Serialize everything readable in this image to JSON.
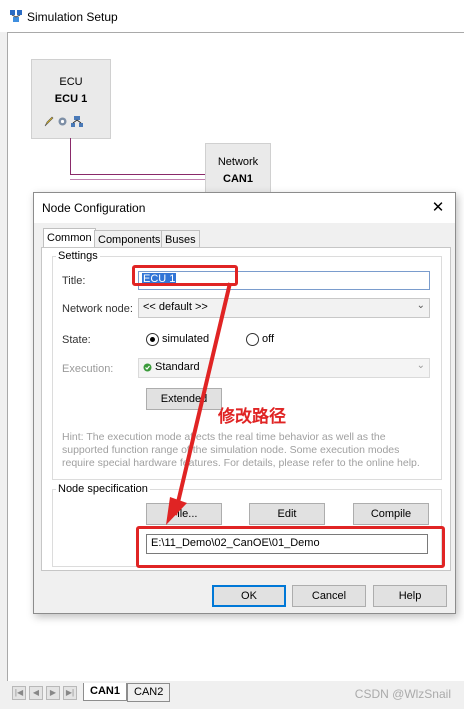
{
  "window": {
    "title": "Simulation Setup"
  },
  "canvas": {
    "ecu_node": {
      "line1": "ECU",
      "line2": "ECU 1"
    },
    "network_node": {
      "line1": "Network",
      "line2": "CAN1"
    }
  },
  "sheet_tabs": [
    "CAN1",
    "CAN2"
  ],
  "watermark": "CSDN @WlzSnail",
  "dialog": {
    "title": "Node Configuration",
    "close_label": "✕",
    "tabs": [
      "Common",
      "Components",
      "Buses"
    ],
    "settings": {
      "group_label": "Settings",
      "title_label": "Title:",
      "title_value": "ECU 1",
      "network_node_label": "Network node:",
      "network_node_value": "<< default >>",
      "state_label": "State:",
      "state_options": [
        "simulated",
        "off"
      ],
      "state_selected": "simulated",
      "execution_label": "Execution:",
      "execution_value": "Standard",
      "extended_button": "Extended",
      "hint": "Hint: The execution mode affects the real time behavior as well as the supported function range of the simulation node. Some execution modes require special hardware features. For details, please refer to the online help."
    },
    "node_spec": {
      "group_label": "Node specification",
      "file_button": "File...",
      "edit_button": "Edit",
      "compile_button": "Compile",
      "path_value": "E:\\11_Demo\\02_CanOE\\01_Demo"
    },
    "footer": {
      "ok": "OK",
      "cancel": "Cancel",
      "help": "Help"
    }
  },
  "annotation": {
    "text": "修改路径",
    "color": "#e02424"
  }
}
